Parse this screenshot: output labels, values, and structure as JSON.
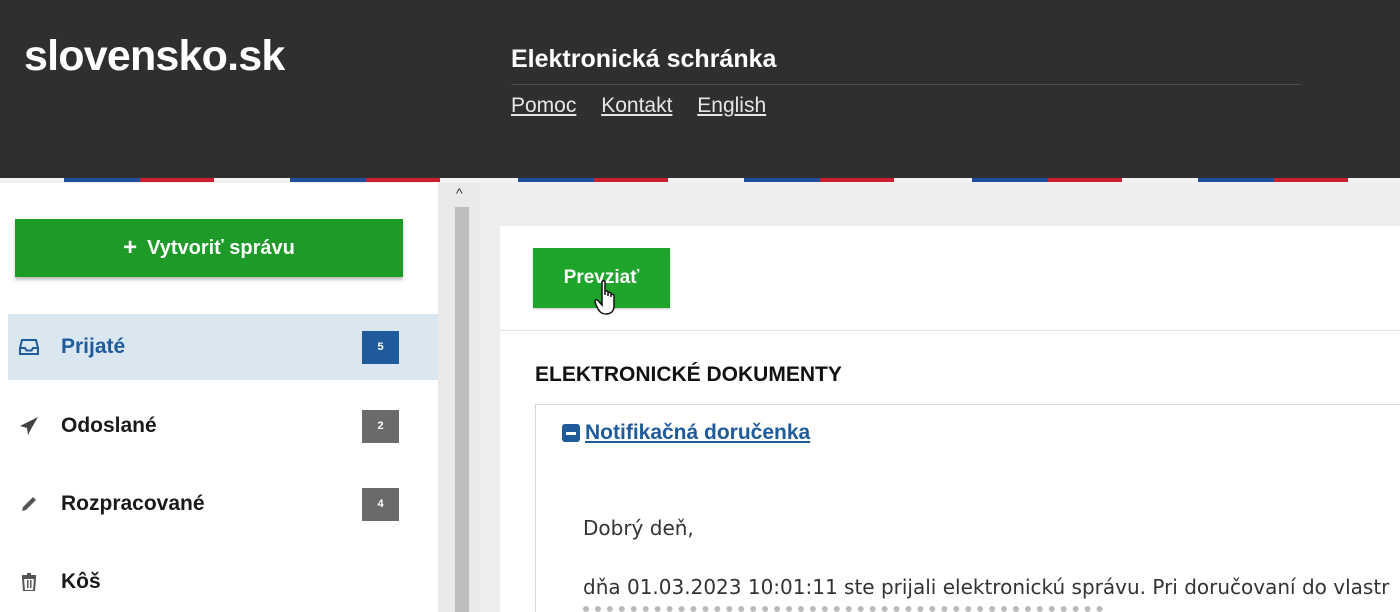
{
  "header": {
    "logo": "slovensko.sk",
    "title": "Elektronická schránka",
    "links": [
      "Pomoc",
      "Kontakt",
      "English"
    ]
  },
  "colors": {
    "topbar": "#2f2f2f",
    "primary_green": "#1e9a28",
    "accent_blue": "#1f5b9b",
    "active_nav_bg": "#dbe7f0",
    "flag_blue": "#1f4e9c",
    "flag_red": "#c8202f"
  },
  "sidebar": {
    "create_button": "Vytvoriť správu",
    "create_icon": "plus-icon",
    "items": [
      {
        "label": "Prijaté",
        "badge": "5",
        "icon": "inbox-icon",
        "active": true
      },
      {
        "label": "Odoslané",
        "badge": "2",
        "icon": "send-icon",
        "active": false
      },
      {
        "label": "Rozpracované",
        "badge": "4",
        "icon": "pencil-icon",
        "active": false
      },
      {
        "label": "Kôš",
        "badge": "",
        "icon": "trash-icon",
        "active": false
      }
    ]
  },
  "main": {
    "take_button": "Prevziať",
    "section_heading": "ELEKTRONICKÉ DOKUMENTY",
    "document": {
      "link": "Notifikačná doručenka",
      "greeting": "Dobrý deň,",
      "body": "dňa 01.03.2023 10:01:11 ste prijali elektronickú správu. Pri doručovaní do vlastr"
    }
  }
}
